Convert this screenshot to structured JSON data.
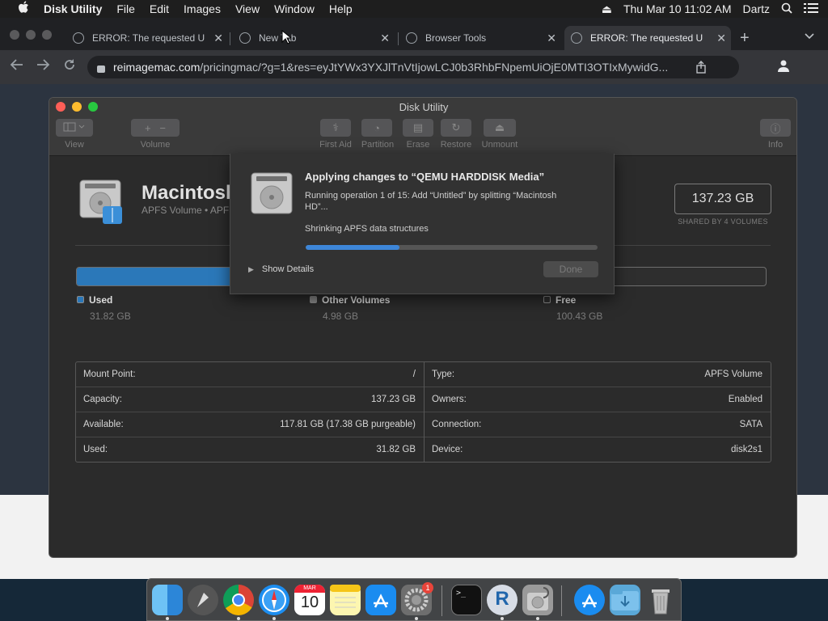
{
  "menubar": {
    "apple": "",
    "app_name": "Disk Utility",
    "menus": [
      "File",
      "Edit",
      "Images",
      "View",
      "Window",
      "Help"
    ],
    "clock": "Thu Mar 10  11:02 AM",
    "user": "Dartz",
    "icons": [
      "eject-icon",
      "search-icon",
      "control-center-icon"
    ]
  },
  "browser": {
    "tabs": [
      {
        "title": "ERROR: The requested U",
        "active": false
      },
      {
        "title": "New Tab",
        "active": false
      },
      {
        "title": "Browser Tools",
        "active": false
      },
      {
        "title": "ERROR: The requested U",
        "active": true
      }
    ],
    "url_host": "reimagemac.com",
    "url_rest": "/pricingmac/?g=1&res=eyJtYWx3YXJlTnVtIjowLCJ0b3RhbFNpemUiOjE0MTI3OTIxMywidG..."
  },
  "disk_utility": {
    "window_title": "Disk Utility",
    "toolbar": [
      {
        "label": "View",
        "icon": "sidebar-icon"
      },
      {
        "label": "Volume",
        "icon": "plus-minus-icon"
      },
      {
        "label": "First Aid",
        "icon": "stethoscope-icon"
      },
      {
        "label": "Partition",
        "icon": "pie-icon"
      },
      {
        "label": "Erase",
        "icon": "erase-icon"
      },
      {
        "label": "Restore",
        "icon": "restore-icon"
      },
      {
        "label": "Unmount",
        "icon": "eject-icon"
      },
      {
        "label": "Info",
        "icon": "info-icon"
      }
    ],
    "volume": {
      "name": "Macintosh HD",
      "subtitle": "APFS Volume • APFS Volume Group",
      "size": "137.23 GB",
      "size_caption": "SHARED BY 4 VOLUMES"
    },
    "usage": {
      "used_fraction": 0.232,
      "legend": [
        {
          "label": "Used",
          "amount": "31.82 GB",
          "color": "#2b78b9"
        },
        {
          "label": "Other Volumes",
          "amount": "4.98 GB",
          "color": "#8a8a8a"
        },
        {
          "label": "Free",
          "amount": "100.43 GB",
          "color": "#2e2e2e"
        }
      ]
    },
    "info_left": [
      {
        "key": "Mount Point:",
        "value": "/"
      },
      {
        "key": "Capacity:",
        "value": "137.23 GB"
      },
      {
        "key": "Available:",
        "value": "117.81 GB (17.38 GB purgeable)"
      },
      {
        "key": "Used:",
        "value": "31.82 GB"
      }
    ],
    "info_right": [
      {
        "key": "Type:",
        "value": "APFS Volume"
      },
      {
        "key": "Owners:",
        "value": "Enabled"
      },
      {
        "key": "Connection:",
        "value": "SATA"
      },
      {
        "key": "Device:",
        "value": "disk2s1"
      }
    ]
  },
  "sheet": {
    "title": "Applying changes to “QEMU HARDDISK Media”",
    "description": "Running operation 1 of 15: Add “Untitled” by splitting “Macintosh HD”...",
    "status": "Shrinking APFS data structures",
    "progress": 0.32,
    "show_details": "Show Details",
    "done": "Done"
  },
  "dock": {
    "items": [
      "Finder",
      "Launchpad",
      "Chrome",
      "Safari",
      "Calendar",
      "Notes",
      "App Store",
      "System Preferences",
      "Terminal",
      "R",
      "Disk Utility",
      "App Store",
      "Downloads",
      "Trash"
    ],
    "calendar_month": "MAR",
    "calendar_day": "10",
    "system_preferences_badge": "1",
    "terminal_prompt": ">_",
    "r_letter": "R"
  }
}
